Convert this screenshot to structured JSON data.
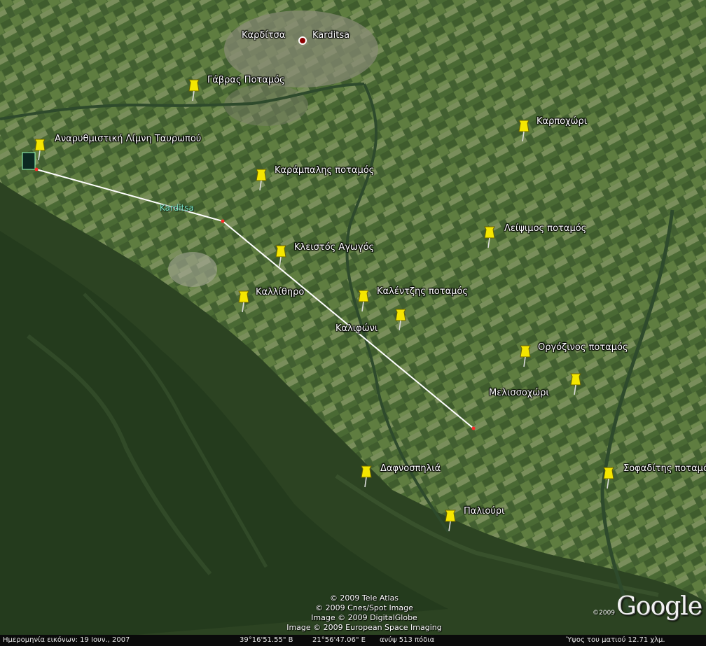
{
  "places": [
    {
      "id": "karditsa",
      "label": "Καρδίτσα",
      "type": "city"
    },
    {
      "id": "karditsa-en",
      "label": "Karditsa",
      "type": "city-en"
    },
    {
      "id": "gavras",
      "label": "Γάβρας Ποταμός",
      "type": "pin"
    },
    {
      "id": "tavropou",
      "label": "Αναρυθμιστική Λίμνη Ταυρωπού",
      "type": "pin"
    },
    {
      "id": "karampalis",
      "label": "Καράμπαλης ποταμός",
      "type": "pin"
    },
    {
      "id": "karpochori",
      "label": "Καρποχώρι",
      "type": "pin"
    },
    {
      "id": "leipsimos",
      "label": "Λείψιμος ποταμός",
      "type": "pin"
    },
    {
      "id": "kleistos",
      "label": "Κλειστός Αγωγός",
      "type": "pin"
    },
    {
      "id": "kallithiro",
      "label": "Καλλίθηρο",
      "type": "pin"
    },
    {
      "id": "kalentzis",
      "label": "Καλέντζης ποταμός",
      "type": "pin"
    },
    {
      "id": "kalifoni",
      "label": "Καλιφώνι",
      "type": "pin"
    },
    {
      "id": "orgozinos",
      "label": "Οργόζινος ποταμός",
      "type": "pin"
    },
    {
      "id": "melissochori",
      "label": "Μελισσοχώρι",
      "type": "pin"
    },
    {
      "id": "dafnospilia",
      "label": "Δαφνοσπηλιά",
      "type": "pin"
    },
    {
      "id": "paliouri",
      "label": "Παλιούρι",
      "type": "pin"
    },
    {
      "id": "sofaditis",
      "label": "Σοφαδίτης ποταμός",
      "type": "pin"
    }
  ],
  "route": {
    "label": "Karditsa",
    "color": "#ffffff",
    "label_color": "#7fe7c6"
  },
  "copyright": [
    "© 2009 Tele Atlas",
    "© 2009 Cnes/Spot Image",
    "Image © 2009 DigitalGlobe",
    "Image © 2009 European Space Imaging"
  ],
  "logo": {
    "year": "©2009",
    "text": "Google"
  },
  "status": {
    "imagery_date": "Ημερομηνία εικόνων: 19 Ιουν., 2007",
    "lat": "39°16'51.55\" Β",
    "lon": "21°56'47.06\" Ε",
    "elevation": "ανύψ   513 πόδια",
    "eye_alt": "Ύψος του ματιού    12.71 χλμ."
  },
  "colors": {
    "pin": "#f5e600",
    "city_dot": "#8b0000",
    "statusbar": "#0a0a0a"
  }
}
